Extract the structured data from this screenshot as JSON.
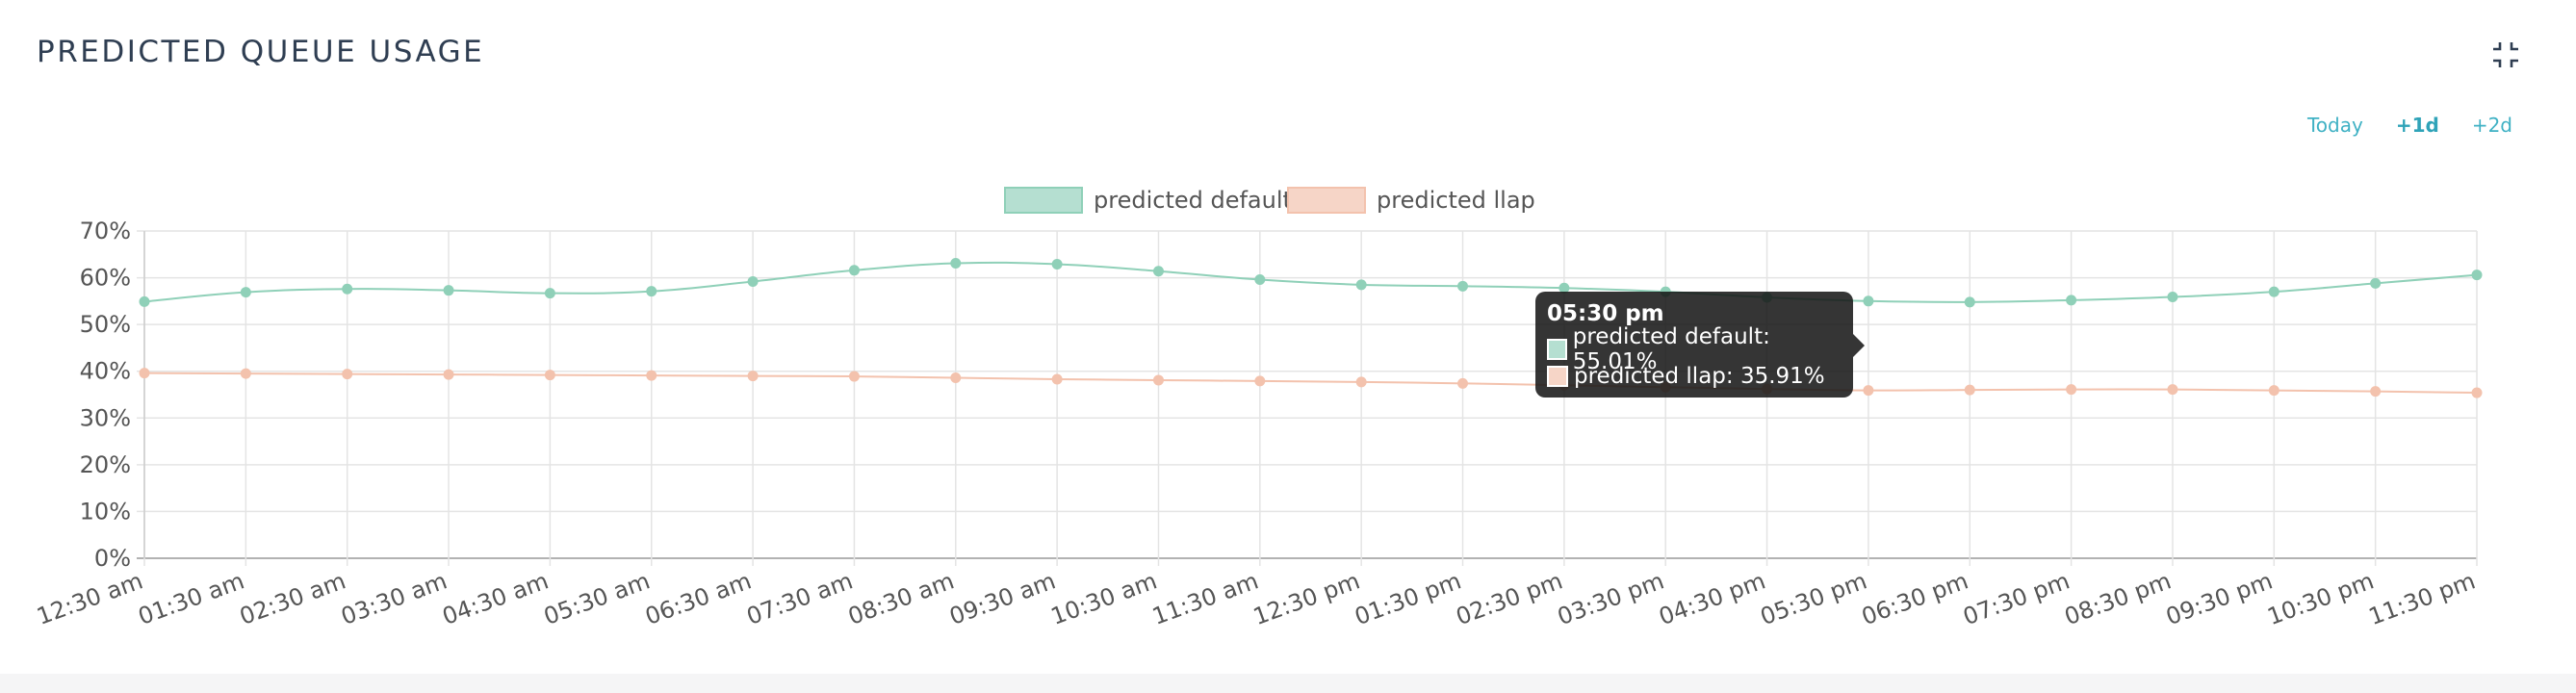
{
  "panel": {
    "title": "PREDICTED QUEUE USAGE"
  },
  "icons": {
    "collapse": "collapse-icon"
  },
  "range_tabs": [
    {
      "label": "Today",
      "active": false
    },
    {
      "label": "+1d",
      "active": true
    },
    {
      "label": "+2d",
      "active": false
    }
  ],
  "colors": {
    "default_line": "#8fd0b8",
    "default_fill": "#b5dfd1",
    "llap_line": "#f3c2ad",
    "llap_fill": "#f6d5c7",
    "tab_accent": "#3fb1c4"
  },
  "tooltip": {
    "title": "05:30 pm",
    "rows": [
      {
        "series": "predicted default",
        "text": "predicted default: 55.01%"
      },
      {
        "series": "predicted llap",
        "text": "predicted llap: 35.91%"
      }
    ]
  },
  "chart_data": {
    "type": "line",
    "legend_position": "top-center",
    "grid": true,
    "ylim": [
      0,
      70
    ],
    "y_ticks": [
      "0%",
      "10%",
      "20%",
      "30%",
      "40%",
      "50%",
      "60%",
      "70%"
    ],
    "x": [
      "12:30 am",
      "01:30 am",
      "02:30 am",
      "03:30 am",
      "04:30 am",
      "05:30 am",
      "06:30 am",
      "07:30 am",
      "08:30 am",
      "09:30 am",
      "10:30 am",
      "11:30 am",
      "12:30 pm",
      "01:30 pm",
      "02:30 pm",
      "03:30 pm",
      "04:30 pm",
      "05:30 pm",
      "06:30 pm",
      "07:30 pm",
      "08:30 pm",
      "09:30 pm",
      "10:30 pm",
      "11:30 pm"
    ],
    "series": [
      {
        "name": "predicted default",
        "values": [
          54.9,
          56.9,
          57.6,
          57.3,
          56.7,
          57.1,
          59.2,
          61.6,
          63.1,
          62.9,
          61.4,
          59.6,
          58.5,
          58.2,
          57.8,
          57.0,
          55.8,
          55.01,
          54.8,
          55.2,
          55.9,
          57.0,
          58.8,
          60.6
        ]
      },
      {
        "name": "predicted llap",
        "values": [
          39.6,
          39.5,
          39.4,
          39.3,
          39.2,
          39.1,
          39.0,
          38.9,
          38.6,
          38.3,
          38.1,
          37.9,
          37.7,
          37.4,
          37.0,
          36.6,
          36.2,
          35.91,
          36.0,
          36.1,
          36.1,
          35.9,
          35.7,
          35.4
        ]
      }
    ]
  }
}
